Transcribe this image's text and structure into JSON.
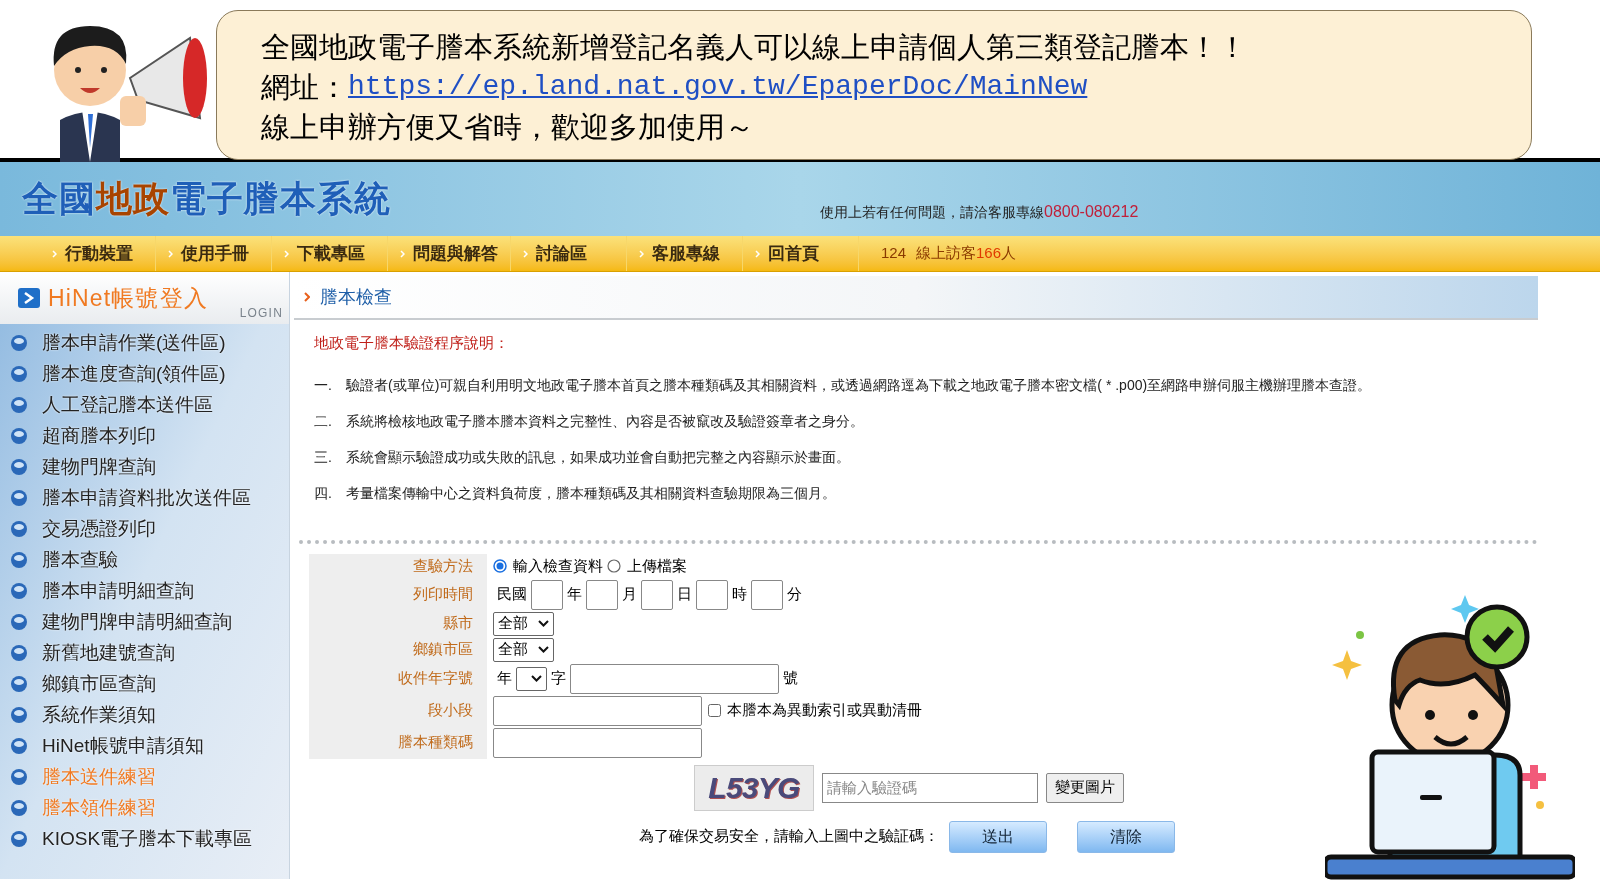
{
  "announcement": {
    "line1": "全國地政電子謄本系統新增登記名義人可以線上申請個人第三類登記謄本！！",
    "url_label": "網址：",
    "url": "https://ep.land.nat.gov.tw/EpaperDoc/MainNew",
    "line3": "線上申辦方便又省時，歡迎多加使用～"
  },
  "header": {
    "logo_parts": [
      {
        "text": "全國",
        "color": "#1f5fb8"
      },
      {
        "text": "地政",
        "color": "#a84400"
      },
      {
        "text": "電子謄本系統",
        "color": "#1f5fb8"
      }
    ],
    "help_text": "使用上若有任何問題，請洽客服專線",
    "hotline": "0800-080212"
  },
  "nav": {
    "items": [
      "行動裝置",
      "使用手冊",
      "下載專區",
      "問題與解答",
      "討論區",
      "客服專線",
      "回首頁"
    ],
    "counter": "124",
    "visitors_label": "線上訪客",
    "visitors_count": "166",
    "visitors_unit": "人"
  },
  "sidebar": {
    "login": "HiNet帳號登入",
    "login_watermark": "LOGIN",
    "items": [
      {
        "label": "謄本申請作業(送件區)",
        "highlighted": false
      },
      {
        "label": "謄本進度查詢(領件區)",
        "highlighted": false
      },
      {
        "label": "人工登記謄本送件區",
        "highlighted": false
      },
      {
        "label": "超商謄本列印",
        "highlighted": false
      },
      {
        "label": "建物門牌查詢",
        "highlighted": false
      },
      {
        "label": "謄本申請資料批次送件區",
        "highlighted": false
      },
      {
        "label": "交易憑證列印",
        "highlighted": false
      },
      {
        "label": "謄本查驗",
        "highlighted": false
      },
      {
        "label": "謄本申請明細查詢",
        "highlighted": false
      },
      {
        "label": "建物門牌申請明細查詢",
        "highlighted": false
      },
      {
        "label": "新舊地建號查詢",
        "highlighted": false
      },
      {
        "label": "鄉鎮市區查詢",
        "highlighted": false
      },
      {
        "label": "系統作業須知",
        "highlighted": false
      },
      {
        "label": "HiNet帳號申請須知",
        "highlighted": false
      },
      {
        "label": "謄本送件練習",
        "highlighted": true
      },
      {
        "label": "謄本領件練習",
        "highlighted": true
      },
      {
        "label": "KIOSK電子謄本下載專區",
        "highlighted": false
      }
    ]
  },
  "main": {
    "title": "謄本檢查",
    "intro_heading": "地政電子謄本驗證程序說明：",
    "steps": [
      {
        "number": "一.",
        "text": "驗證者(或單位)可親自利用明文地政電子謄本首頁之謄本種類碼及其相關資料，或透過網路逕為下載之地政電子謄本密文檔( * .p00)至網路申辦伺服主機辦理謄本查證。"
      },
      {
        "number": "二.",
        "text": "系統將檢核地政電子謄本謄本資料之完整性、內容是否被竄改及驗證簽章者之身分。"
      },
      {
        "number": "三.",
        "text": "系統會顯示驗證成功或失敗的訊息，如果成功並會自動把完整之內容顯示於畫面。"
      },
      {
        "number": "四.",
        "text": "考量檔案傳輸中心之資料負荷度，謄本種類碼及其相關資料查驗期限為三個月。"
      }
    ],
    "form": {
      "rows": [
        {
          "kind": "radio",
          "label": "查驗方法",
          "options": [
            {
              "label": "輸入檢查資料",
              "selected": true
            },
            {
              "label": "上傳檔案",
              "selected": false
            }
          ]
        },
        {
          "kind": "datetime",
          "label": "列印時間",
          "prefix": "民國",
          "units": [
            "年",
            "月",
            "日",
            "時",
            "分"
          ]
        },
        {
          "kind": "select",
          "label": "縣市",
          "value": "全部"
        },
        {
          "kind": "select",
          "label": "鄉鎮市區",
          "value": "全部"
        },
        {
          "kind": "receipt",
          "label": "收件年字號",
          "parts": [
            "年",
            "字",
            "號"
          ]
        },
        {
          "kind": "section",
          "label": "段小段",
          "checkbox": {
            "label": "本謄本為異動索引或異動清冊",
            "checked": false
          }
        },
        {
          "kind": "text",
          "label": "謄本種類碼"
        }
      ],
      "captcha": {
        "text": "L53YG",
        "placeholder": "請輸入驗證碼",
        "refresh": "變更圖片"
      },
      "prompt": "為了確保交易安全，請輸入上圖中之驗証碼：",
      "buttons": [
        "送出",
        "清除"
      ]
    }
  }
}
